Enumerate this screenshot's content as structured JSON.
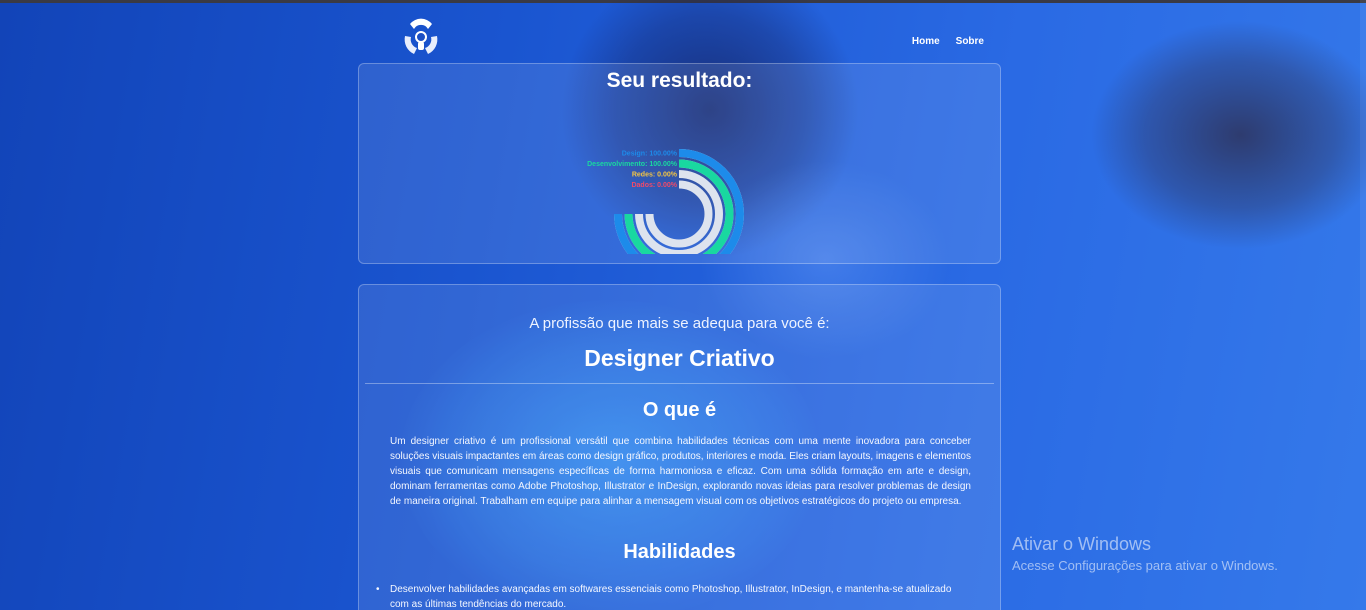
{
  "nav": {
    "logo_icon": "team-logo-icon",
    "links": [
      "Home",
      "Sobre"
    ]
  },
  "result": {
    "title": "Seu resultado:"
  },
  "chart_data": {
    "type": "radialBar",
    "unit": "%",
    "series": [
      {
        "name": "Design",
        "label": "Design: 100.00%",
        "value": 100.0,
        "color": "#1d8bea"
      },
      {
        "name": "Desenvolvimento",
        "label": "Desenvolvimento: 100.00%",
        "value": 100.0,
        "color": "#19d8a0"
      },
      {
        "name": "Redes",
        "label": "Redes: 0.00%",
        "value": 0.0,
        "color": "#f5c542"
      },
      {
        "name": "Dados",
        "label": "Dados: 0.00%",
        "value": 0.0,
        "color": "#ef4a6a"
      }
    ],
    "track_color": "#dde3ee",
    "max": 100
  },
  "profession": {
    "intro": "A profissão que mais se adequa para você é:",
    "name": "Designer Criativo",
    "what_title": "O que é",
    "description": "Um designer criativo é um profissional versátil que combina habilidades técnicas com uma mente inovadora para conceber soluções visuais impactantes em áreas como design gráfico, produtos, interiores e moda. Eles criam layouts, imagens e elementos visuais que comunicam mensagens específicas de forma harmoniosa e eficaz. Com uma sólida formação em arte e design, dominam ferramentas como Adobe Photoshop, Illustrator e InDesign, explorando novas ideias para resolver problemas de design de maneira original. Trabalham em equipe para alinhar a mensagem visual com os objetivos estratégicos do projeto ou empresa.",
    "skills_title": "Habilidades",
    "skills": [
      "Desenvolver habilidades avançadas em softwares essenciais como Photoshop, Illustrator, InDesign, e mantenha-se atualizado com as últimas tendências do mercado."
    ]
  },
  "watermark": {
    "title": "Ativar o Windows",
    "subtitle": "Acesse Configurações para ativar o Windows."
  }
}
